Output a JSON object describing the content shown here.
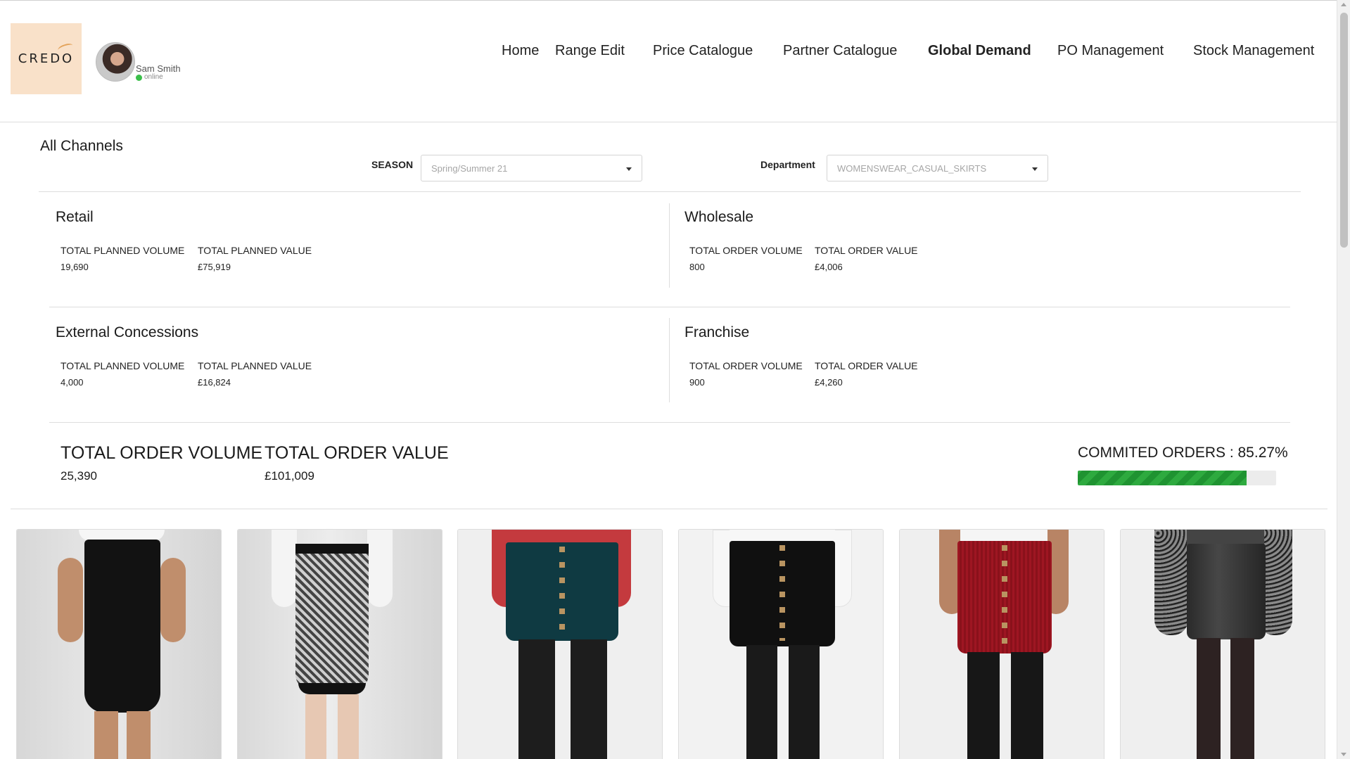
{
  "app": {
    "logo_text": "CREDO",
    "user": {
      "name": "Sam Smith",
      "status": "online"
    }
  },
  "nav": {
    "items": [
      {
        "label": "Home"
      },
      {
        "label": "Range Edit"
      },
      {
        "label": "Price Catalogue"
      },
      {
        "label": "Partner Catalogue"
      },
      {
        "label": "Global Demand",
        "active": true
      },
      {
        "label": "PO Management"
      },
      {
        "label": "Stock Management"
      }
    ]
  },
  "page": {
    "title": "All Channels",
    "season": {
      "label": "SEASON",
      "value": "Spring/Summer 21"
    },
    "department": {
      "label": "Department",
      "value": "WOMENSWEAR_CASUAL_SKIRTS"
    }
  },
  "channels": {
    "retail": {
      "title": "Retail",
      "m1": {
        "label": "TOTAL PLANNED VOLUME",
        "value": "19,690"
      },
      "m2": {
        "label": "TOTAL PLANNED VALUE",
        "value": "£75,919"
      }
    },
    "wholesale": {
      "title": "Wholesale",
      "m1": {
        "label": "TOTAL ORDER VOLUME",
        "value": "800"
      },
      "m2": {
        "label": "TOTAL ORDER VALUE",
        "value": "£4,006"
      }
    },
    "external": {
      "title": "External Concessions",
      "m1": {
        "label": "TOTAL PLANNED VOLUME",
        "value": "4,000"
      },
      "m2": {
        "label": "TOTAL PLANNED VALUE",
        "value": "£16,824"
      }
    },
    "franchise": {
      "title": "Franchise",
      "m1": {
        "label": "TOTAL ORDER VOLUME",
        "value": "900"
      },
      "m2": {
        "label": "TOTAL ORDER VALUE",
        "value": "£4,260"
      }
    }
  },
  "totals": {
    "volume": {
      "label": "TOTAL ORDER VOLUME",
      "value": "25,390"
    },
    "value": {
      "label": "TOTAL ORDER VALUE",
      "value": "£101,009"
    },
    "committed": {
      "label": "COMMITED ORDERS : 85.27%",
      "percent": 85.27
    }
  },
  "colors": {
    "logo_bg": "#f9e1c9",
    "online": "#3bbf4a",
    "progress": "#2eaa3f",
    "progress_track": "#ececec"
  },
  "products": [
    {
      "image": "black-pencil-skirt"
    },
    {
      "image": "geometric-knit-pencil-skirt"
    },
    {
      "image": "teal-button-front-skirt"
    },
    {
      "image": "black-button-front-skirt"
    },
    {
      "image": "red-cord-button-skirt"
    },
    {
      "image": "black-faux-leather-skirt"
    }
  ]
}
